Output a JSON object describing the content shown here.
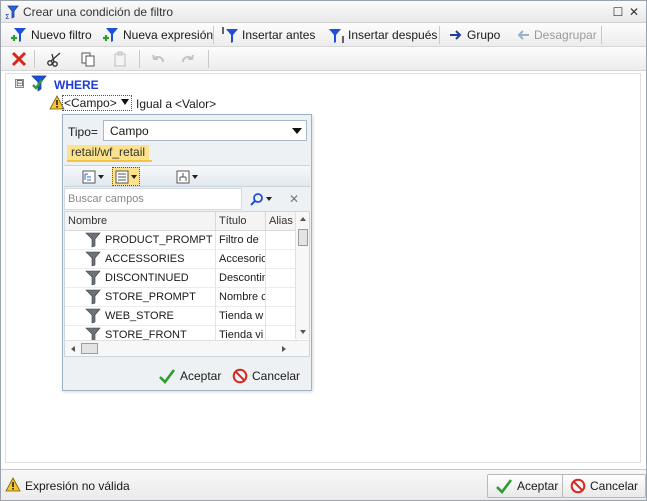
{
  "window": {
    "title": "Crear una condición de filtro",
    "maximize_glyph": "☐",
    "close_glyph": "✕"
  },
  "toolbar": {
    "new_filter": "Nuevo filtro",
    "new_expression": "Nueva expresión",
    "insert_before": "Insertar antes",
    "insert_after": "Insertar después",
    "group": "Grupo",
    "ungroup": "Desagrupar"
  },
  "tree": {
    "toggle": "⊟",
    "root_label": "WHERE",
    "condition": {
      "field": "<Campo>",
      "operator": "Igual a",
      "value": "<Valor>"
    }
  },
  "popup": {
    "tipo_label": "Tipo=",
    "tipo_value": "Campo",
    "source": "retail/wf_retail",
    "search_placeholder": "Buscar campos",
    "clear_glyph": "✕",
    "columns": [
      "Nombre",
      "Título",
      "Alias"
    ],
    "rows": [
      {
        "name": "PRODUCT_PROMPT",
        "title": "Filtro de ",
        "alias": ""
      },
      {
        "name": "ACCESSORIES",
        "title": "Accesorio",
        "alias": ""
      },
      {
        "name": "DISCONTINUED",
        "title": "Descontin",
        "alias": ""
      },
      {
        "name": "STORE_PROMPT",
        "title": "Nombre c",
        "alias": ""
      },
      {
        "name": "WEB_STORE",
        "title": "Tienda w",
        "alias": ""
      },
      {
        "name": "STORE_FRONT",
        "title": "Tienda vi",
        "alias": ""
      }
    ],
    "accept": "Aceptar",
    "cancel": "Cancelar"
  },
  "status": {
    "message": "Expresión no válida",
    "accept": "Aceptar",
    "cancel": "Cancelar"
  },
  "colors": {
    "where_blue": "#1f3bd1",
    "filter_blue": "#1e4fd8",
    "check_green": "#2e9c2e",
    "cancel_red": "#d9261c",
    "highlight_yellow": "#fce28a"
  }
}
